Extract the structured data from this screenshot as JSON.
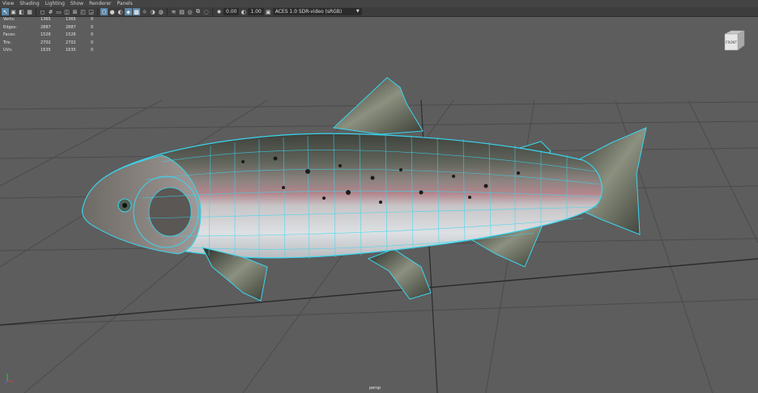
{
  "menu": [
    "View",
    "Shading",
    "Lighting",
    "Show",
    "Renderer",
    "Panels"
  ],
  "toolbar": {
    "near_clip": "0.00",
    "gamma": "1.00",
    "color_space": "ACES 1.0 SDR-video (sRGB)"
  },
  "hud": {
    "rows": [
      {
        "label": "Verts:",
        "a": "1365",
        "b": "1365",
        "c": "0"
      },
      {
        "label": "Edges:",
        "a": "2887",
        "b": "2887",
        "c": "0"
      },
      {
        "label": "Faces:",
        "a": "1526",
        "b": "1526",
        "c": "0"
      },
      {
        "label": "Tris:",
        "a": "2702",
        "b": "2702",
        "c": "0"
      },
      {
        "label": "UVs:",
        "a": "1635",
        "b": "1635",
        "c": "0"
      }
    ]
  },
  "viewcube": {
    "face_label": "FRONT"
  },
  "camera": "persp",
  "colors": {
    "wireframe": "#39d6f0",
    "viewport_bg": "#5d5d5d",
    "grid": "#4a4a4a"
  }
}
